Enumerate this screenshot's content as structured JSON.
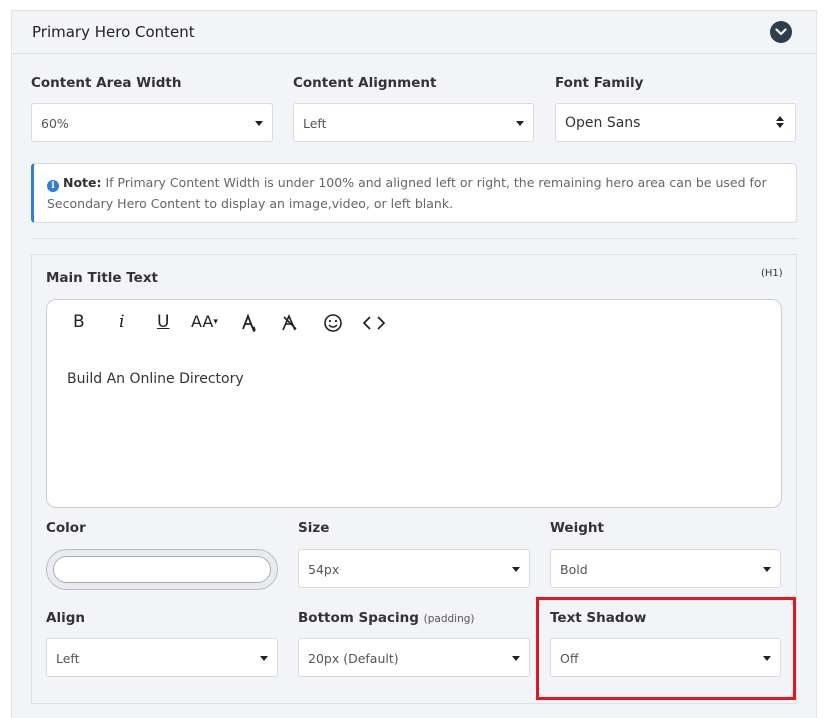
{
  "panel": {
    "title": "Primary Hero Content",
    "icons": {
      "collapse": "chevron-down-icon"
    }
  },
  "layout_fields": {
    "width": {
      "label": "Content Area Width",
      "value": "60%"
    },
    "alignment": {
      "label": "Content Alignment",
      "value": "Left"
    },
    "font": {
      "label": "Font Family",
      "value": "Open Sans"
    }
  },
  "note": {
    "icon": "info-icon",
    "bold": "Note:",
    "text": "If Primary Content Width is under 100% and aligned left or right, the remaining hero area can be used for Secondary Hero Content to display an image,video, or left blank."
  },
  "main_title": {
    "label": "Main Title Text",
    "tag": "(H1)",
    "editor_text": "Build An Online Directory",
    "toolbar": {
      "bold": "B",
      "italic": "i",
      "underline": "U",
      "font_size": "AA",
      "icons": [
        "bold-icon",
        "italic-icon",
        "underline-icon",
        "font-size-icon",
        "text-color-icon",
        "clear-format-icon",
        "emoji-icon",
        "code-view-icon"
      ]
    }
  },
  "style_fields": {
    "color": {
      "label": "Color",
      "value": "#ffffff"
    },
    "size": {
      "label": "Size",
      "value": "54px"
    },
    "weight": {
      "label": "Weight",
      "value": "Bold"
    },
    "align": {
      "label": "Align",
      "value": "Left"
    },
    "bottom_spacing": {
      "label": "Bottom Spacing",
      "label_note": "(padding)",
      "value": "20px (Default)"
    },
    "text_shadow": {
      "label": "Text Shadow",
      "value": "Off"
    }
  },
  "colors": {
    "accent": "#2f7ed8",
    "header_button": "#2d3e50",
    "highlight": "#e0191e"
  }
}
